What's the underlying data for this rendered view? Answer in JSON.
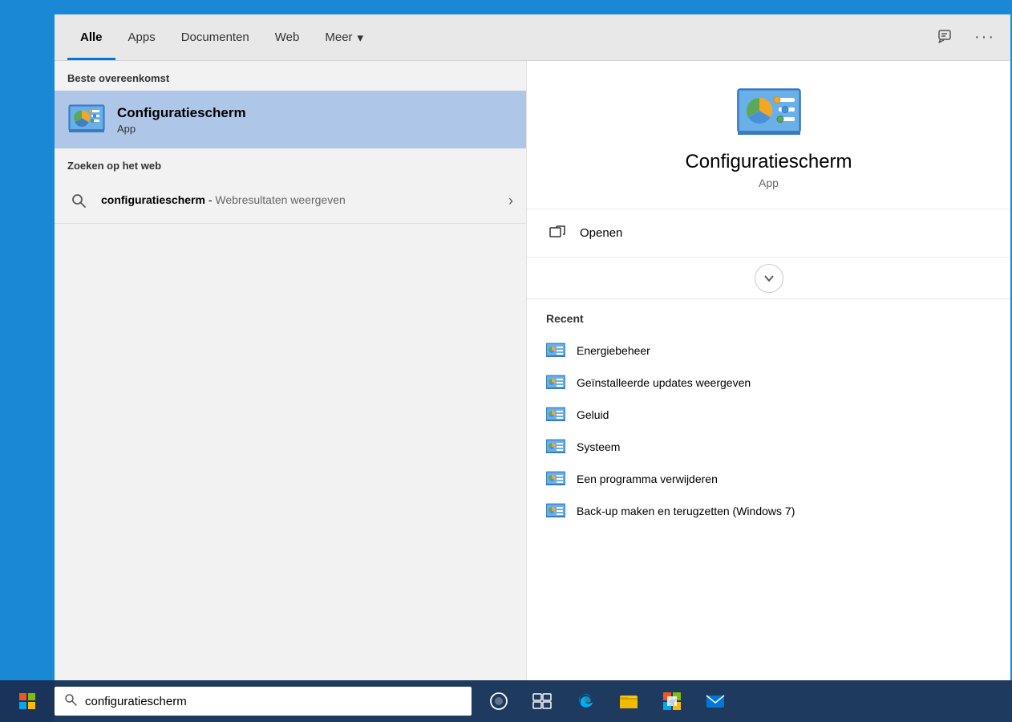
{
  "tabs": [
    {
      "id": "alle",
      "label": "Alle",
      "active": true
    },
    {
      "id": "apps",
      "label": "Apps",
      "active": false
    },
    {
      "id": "documenten",
      "label": "Documenten",
      "active": false
    },
    {
      "id": "web",
      "label": "Web",
      "active": false
    },
    {
      "id": "meer",
      "label": "Meer",
      "active": false,
      "hasDropdown": true
    }
  ],
  "section_labels": {
    "best_match": "Beste overeenkomst",
    "web_search": "Zoeken op het web",
    "recent": "Recent"
  },
  "best_match": {
    "title": "Configuratiescherm",
    "subtitle": "App"
  },
  "web_search": {
    "query": "configuratiescherm",
    "separator": " - ",
    "description": "Webresultaten weergeven"
  },
  "app_detail": {
    "title": "Configuratiescherm",
    "subtitle": "App",
    "open_label": "Openen"
  },
  "recent_items": [
    {
      "label": "Energiebeheer"
    },
    {
      "label": "Geïnstalleerde updates weergeven"
    },
    {
      "label": "Geluid"
    },
    {
      "label": "Systeem"
    },
    {
      "label": "Een programma verwijderen"
    },
    {
      "label": "Back-up maken en terugzetten (Windows 7)"
    }
  ],
  "taskbar": {
    "search_text": "configuratiescherm"
  },
  "colors": {
    "accent": "#0078d7",
    "active_tab_underline": "#0078d7",
    "best_match_bg": "#aec6e8",
    "taskbar_bg": "#1e3a5f"
  }
}
